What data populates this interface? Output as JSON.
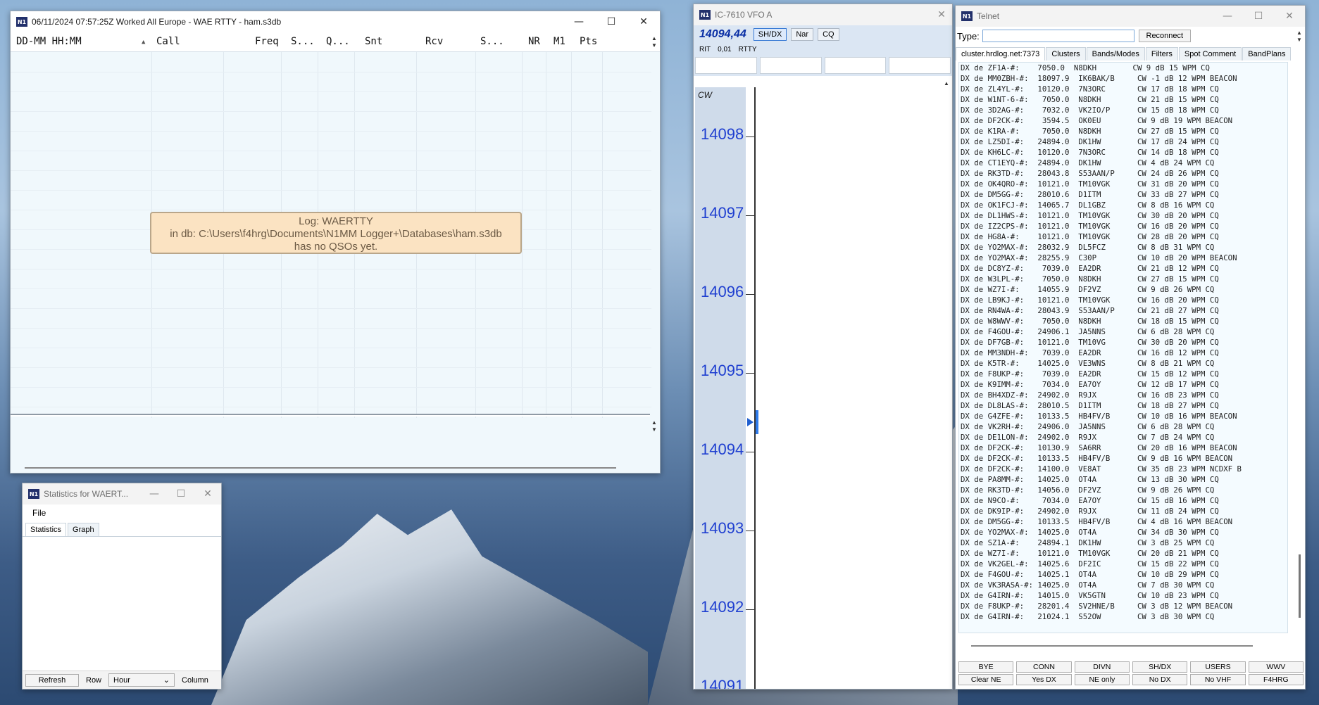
{
  "log_window": {
    "title": "06/11/2024 07:57:25Z  Worked All Europe - WAE RTTY - ham.s3db",
    "columns": [
      "DD-MM HH:MM",
      "Call",
      "Freq",
      "S...",
      "Q...",
      "Snt",
      "Rcv",
      "S...",
      "NR",
      "M1",
      "Pts"
    ],
    "empty_message": {
      "line1": "Log: WAERTTY",
      "line2": "in db: C:\\Users\\f4hrg\\Documents\\N1MM Logger+\\Databases\\ham.s3db",
      "line3": "has no QSOs yet."
    }
  },
  "stats_window": {
    "title": "Statistics for WAERT...",
    "menu_file": "File",
    "tabs": [
      "Statistics",
      "Graph"
    ],
    "refresh": "Refresh",
    "row": "Row",
    "hour": "Hour",
    "column": "Column"
  },
  "bandmap": {
    "title": "IC-7610 VFO A",
    "vfo_freq": "14094,44",
    "buttons": [
      "SH/DX",
      "Nar",
      "CQ"
    ],
    "rit": "RIT",
    "rit_value": "0,01",
    "mode_label": "RTTY",
    "scale_mode": "CW",
    "frequencies": [
      "14098",
      "14097",
      "14096",
      "14095",
      "14094",
      "14093",
      "14092",
      "14091"
    ]
  },
  "telnet": {
    "title": "Telnet",
    "type_label": "Type:",
    "reconnect": "Reconnect",
    "tabs": [
      "cluster.hrdlog.net:7373",
      "Clusters",
      "Bands/Modes",
      "Filters",
      "Spot Comment",
      "BandPlans"
    ],
    "spots": [
      "DX de ZF1A-#:    7050.0  N8DKH        CW 9 dB 15 WPM CQ",
      "DX de MM0ZBH-#:  18097.9  IK6BAK/B     CW -1 dB 12 WPM BEACON",
      "DX de ZL4YL-#:   10120.0  7N3ORC       CW 17 dB 18 WPM CQ",
      "DX de W1NT-6-#:   7050.0  N8DKH        CW 21 dB 15 WPM CQ",
      "DX de 3D2AG-#:    7032.0  VK2IO/P      CW 15 dB 18 WPM CQ",
      "DX de DF2CK-#:    3594.5  OK0EU        CW 9 dB 19 WPM BEACON",
      "DX de K1RA-#:     7050.0  N8DKH        CW 27 dB 15 WPM CQ",
      "DX de LZ5DI-#:   24894.0  DK1HW        CW 17 dB 24 WPM CQ",
      "DX de KH6LC-#:   10120.0  7N3ORC       CW 14 dB 18 WPM CQ",
      "DX de CT1EYQ-#:  24894.0  DK1HW        CW 4 dB 24 WPM CQ",
      "DX de RK3TD-#:   28043.8  S53AAN/P     CW 24 dB 26 WPM CQ",
      "DX de OK4QRO-#:  10121.0  TM10VGK      CW 31 dB 20 WPM CQ",
      "DX de DM5GG-#:   28010.6  D1ITM        CW 33 dB 27 WPM CQ",
      "DX de OK1FCJ-#:  14065.7  DL1GBZ       CW 8 dB 16 WPM CQ",
      "DX de DL1HWS-#:  10121.0  TM10VGK      CW 30 dB 20 WPM CQ",
      "DX de IZ2CPS-#:  10121.0  TM10VGK      CW 16 dB 20 WPM CQ",
      "DX de HG8A-#:    10121.0  TM10VGK      CW 28 dB 20 WPM CQ",
      "DX de YO2MAX-#:  28032.9  DL5FCZ       CW 8 dB 31 WPM CQ",
      "DX de YO2MAX-#:  28255.9  C30P         CW 10 dB 20 WPM BEACON",
      "DX de DC8YZ-#:    7039.0  EA2DR        CW 21 dB 12 WPM CQ",
      "DX de W3LPL-#:    7050.0  N8DKH        CW 27 dB 15 WPM CQ",
      "DX de WZ7I-#:    14055.9  DF2VZ        CW 9 dB 26 WPM CQ",
      "DX de LB9KJ-#:   10121.0  TM10VGK      CW 16 dB 20 WPM CQ",
      "DX de RN4WA-#:   28043.9  S53AAN/P     CW 21 dB 27 WPM CQ",
      "DX de W8WWV-#:    7050.0  N8DKH        CW 18 dB 15 WPM CQ",
      "DX de F4GOU-#:   24906.1  JA5NNS       CW 6 dB 28 WPM CQ",
      "DX de DF7GB-#:   10121.0  TM10VG       CW 30 dB 20 WPM CQ",
      "DX de MM3NDH-#:   7039.0  EA2DR        CW 16 dB 12 WPM CQ",
      "DX de K5TR-#:    14025.0  VE3WNS       CW 8 dB 21 WPM CQ",
      "DX de F8UKP-#:    7039.0  EA2DR        CW 15 dB 12 WPM CQ",
      "DX de K9IMM-#:    7034.0  EA7OY        CW 12 dB 17 WPM CQ",
      "DX de BH4XDZ-#:  24902.0  R9JX         CW 16 dB 23 WPM CQ",
      "DX de DL8LAS-#:  28010.5  D1ITM        CW 18 dB 27 WPM CQ",
      "DX de G4ZFE-#:   10133.5  HB4FV/B      CW 10 dB 16 WPM BEACON",
      "DX de VK2RH-#:   24906.0  JA5NNS       CW 6 dB 28 WPM CQ",
      "DX de DE1LON-#:  24902.0  R9JX         CW 7 dB 24 WPM CQ",
      "DX de DF2CK-#:   10130.9  SA6RR        CW 20 dB 16 WPM BEACON",
      "DX de DF2CK-#:   10133.5  HB4FV/B      CW 9 dB 16 WPM BEACON",
      "DX de DF2CK-#:   14100.0  VE8AT        CW 35 dB 23 WPM NCDXF B",
      "DX de PA8MM-#:   14025.0  OT4A         CW 13 dB 30 WPM CQ",
      "DX de RK3TD-#:   14056.0  DF2VZ        CW 9 dB 26 WPM CQ",
      "DX de N9CO-#:     7034.0  EA7OY        CW 15 dB 16 WPM CQ",
      "DX de DK9IP-#:   24902.0  R9JX         CW 11 dB 24 WPM CQ",
      "DX de DM5GG-#:   10133.5  HB4FV/B      CW 4 dB 16 WPM BEACON",
      "DX de YO2MAX-#:  14025.0  OT4A         CW 34 dB 30 WPM CQ",
      "DX de SZ1A-#:    24894.1  DK1HW        CW 3 dB 25 WPM CQ",
      "DX de WZ7I-#:    10121.0  TM10VGK      CW 20 dB 21 WPM CQ",
      "DX de VK2GEL-#:  14025.6  DF2IC        CW 15 dB 22 WPM CQ",
      "DX de F4GOU-#:   14025.1  OT4A         CW 10 dB 29 WPM CQ",
      "DX de VK3RASA-#: 14025.0  OT4A         CW 7 dB 30 WPM CQ",
      "DX de G4IRN-#:   14015.0  VK5GTN       CW 10 dB 23 WPM CQ",
      "DX de F8UKP-#:   28201.4  SV2HNE/B     CW 3 dB 12 WPM BEACON",
      "DX de G4IRN-#:   21024.1  S52OW        CW 3 dB 30 WPM CQ"
    ],
    "buttons_row1": [
      "BYE",
      "CONN",
      "DIVN",
      "SH/DX",
      "USERS",
      "WWV"
    ],
    "buttons_row2": [
      "Clear NE",
      "Yes DX",
      "NE only",
      "No DX",
      "No VHF",
      "F4HRG"
    ]
  }
}
